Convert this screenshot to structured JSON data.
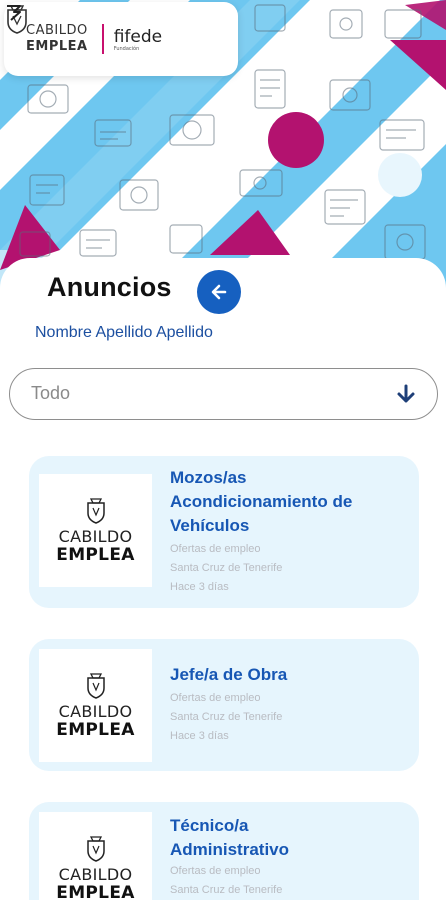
{
  "header": {
    "brand_line1": "CABILDO",
    "brand_line2": "EMPLEA",
    "partner_name": "fifede",
    "partner_sub": "Fundación"
  },
  "page": {
    "title": "Anuncios",
    "back_icon": "arrow-left-icon",
    "user_name": "Nombre Apellido Apellido"
  },
  "filter": {
    "selected": "Todo",
    "icon": "arrow-down-icon"
  },
  "colors": {
    "accent_blue": "#1660c0",
    "title_blue": "#1757b4",
    "card_bg": "#e6f5fd",
    "banner_blue": "#6ec7f0",
    "banner_magenta": "#b3126f"
  },
  "listings": [
    {
      "title": "Mozos/as Acondicionamiento de Vehículos",
      "category": "Ofertas de empleo",
      "location": "Santa Cruz de Tenerife",
      "posted": "Hace 3 días",
      "logo_line1": "CABILDO",
      "logo_line2": "EMPLEA"
    },
    {
      "title": "Jefe/a de Obra",
      "category": "Ofertas de empleo",
      "location": "Santa Cruz de Tenerife",
      "posted": "Hace 3 días",
      "logo_line1": "CABILDO",
      "logo_line2": "EMPLEA"
    },
    {
      "title": "Técnico/a Administrativo",
      "category": "Ofertas de empleo",
      "location": "Santa Cruz de Tenerife",
      "posted": "",
      "logo_line1": "CABILDO",
      "logo_line2": "EMPLEA"
    }
  ]
}
